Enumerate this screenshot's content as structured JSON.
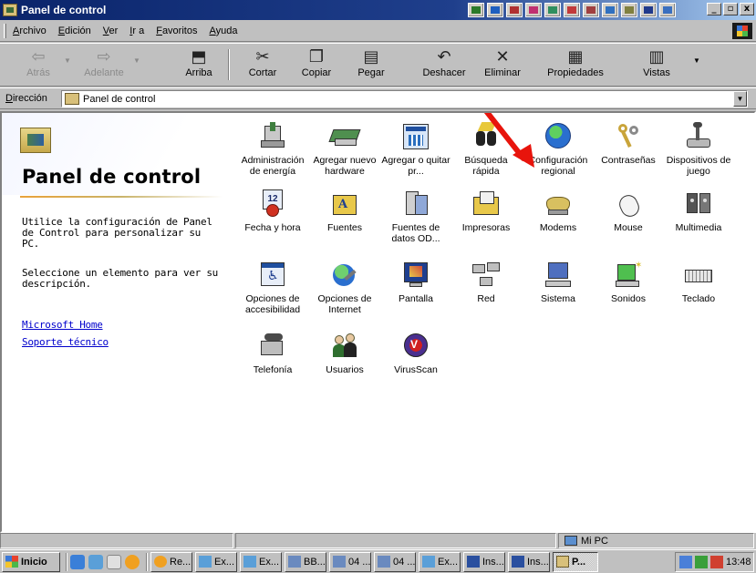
{
  "window": {
    "title": "Panel de control"
  },
  "menu": [
    "Archivo",
    "Edición",
    "Ver",
    "Ir a",
    "Favoritos",
    "Ayuda"
  ],
  "toolbar": {
    "back": "Atrás",
    "forward": "Adelante",
    "up": "Arriba",
    "cut": "Cortar",
    "copy": "Copiar",
    "paste": "Pegar",
    "undo": "Deshacer",
    "delete": "Eliminar",
    "properties": "Propiedades",
    "views": "Vistas"
  },
  "address": {
    "label": "Dirección",
    "value": "Panel de control"
  },
  "left_panel": {
    "title": "Panel de control",
    "description": "Utilice la configuración de Panel de Control para personalizar su PC.",
    "hint": "Seleccione un elemento para ver su descripción.",
    "links": [
      "Microsoft Home",
      "Soporte técnico"
    ]
  },
  "icons": [
    {
      "label": "Administración de energía",
      "icon": "power-management-icon"
    },
    {
      "label": "Agregar nuevo hardware",
      "icon": "add-hardware-icon"
    },
    {
      "label": "Agregar o quitar pr...",
      "icon": "add-remove-programs-icon"
    },
    {
      "label": "Búsqueda rápida",
      "icon": "find-fast-icon"
    },
    {
      "label": "Configuración regional",
      "icon": "regional-settings-icon"
    },
    {
      "label": "Contraseñas",
      "icon": "passwords-icon"
    },
    {
      "label": "Dispositivos de juego",
      "icon": "game-controllers-icon"
    },
    {
      "label": "Fecha y hora",
      "icon": "date-time-icon"
    },
    {
      "label": "Fuentes",
      "icon": "fonts-icon"
    },
    {
      "label": "Fuentes de datos OD...",
      "icon": "odbc-icon"
    },
    {
      "label": "Impresoras",
      "icon": "printers-icon"
    },
    {
      "label": "Modems",
      "icon": "modems-icon"
    },
    {
      "label": "Mouse",
      "icon": "mouse-icon"
    },
    {
      "label": "Multimedia",
      "icon": "multimedia-icon"
    },
    {
      "label": "Opciones de accesibilidad",
      "icon": "accessibility-icon"
    },
    {
      "label": "Opciones de Internet",
      "icon": "internet-options-icon"
    },
    {
      "label": "Pantalla",
      "icon": "display-icon"
    },
    {
      "label": "Red",
      "icon": "network-icon"
    },
    {
      "label": "Sistema",
      "icon": "system-icon"
    },
    {
      "label": "Sonidos",
      "icon": "sounds-icon"
    },
    {
      "label": "Teclado",
      "icon": "keyboard-icon"
    },
    {
      "label": "Telefonía",
      "icon": "telephony-icon"
    },
    {
      "label": "Usuarios",
      "icon": "users-icon"
    },
    {
      "label": "VirusScan",
      "icon": "virusscan-icon"
    }
  ],
  "status": {
    "location": "Mi PC"
  },
  "taskbar": {
    "start": "Inicio",
    "tasks": [
      "Re...",
      "Ex...",
      "Ex...",
      "BB...",
      "04 ...",
      "04 ...",
      "Ex...",
      "Ins...",
      "Ins...",
      "P..."
    ],
    "clock": "13:48"
  },
  "colors": {
    "title_bar": "#0a246a",
    "link": "#0000cc",
    "arrow": "#e8140c",
    "window_face": "#c0c0c0"
  }
}
